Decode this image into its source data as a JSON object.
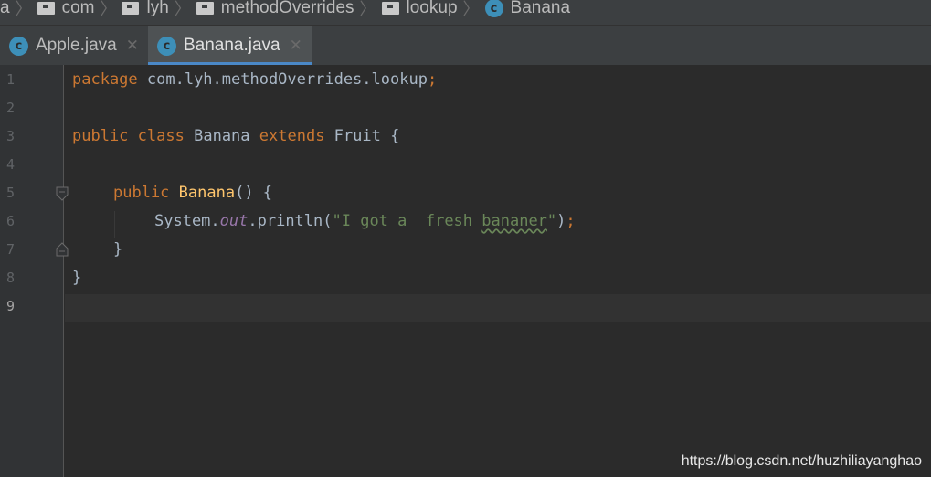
{
  "breadcrumb": {
    "items": [
      {
        "label": "a",
        "icon": "none"
      },
      {
        "label": "com",
        "icon": "folder-icon"
      },
      {
        "label": "lyh",
        "icon": "folder-icon"
      },
      {
        "label": "methodOverrides",
        "icon": "folder-icon"
      },
      {
        "label": "lookup",
        "icon": "folder-icon"
      },
      {
        "label": "Banana",
        "icon": "class-icon"
      }
    ]
  },
  "tabs": [
    {
      "label": "Apple.java",
      "icon_letter": "c",
      "active": false
    },
    {
      "label": "Banana.java",
      "icon_letter": "c",
      "active": true
    }
  ],
  "editor": {
    "line_numbers": [
      "1",
      "2",
      "3",
      "4",
      "5",
      "6",
      "7",
      "8",
      "9"
    ],
    "current_line": "9",
    "code": {
      "l1_kw": "package",
      "l1_rest": " com.lyh.methodOverrides.lookup",
      "l1_semi": ";",
      "l3_kw1": "public",
      "l3_kw2": "class",
      "l3_name": "Banana",
      "l3_kw3": "extends",
      "l3_rest": " Fruit {",
      "l5_kw": "public",
      "l5_fn": "Banana",
      "l5_rest": "() {",
      "l6_sys": "System.",
      "l6_out": "out",
      "l6_print": ".println(",
      "l6_str1": "\"I got a  fresh ",
      "l6_str_typo": "bananer",
      "l6_str2": "\"",
      "l6_end": ")",
      "l6_semi": ";",
      "l7": "}",
      "l8": "}"
    },
    "colors": {
      "keyword": "#cc7832",
      "function": "#ffc66d",
      "string": "#6a8759",
      "static_field": "#9876aa",
      "text": "#a9b7c6",
      "background": "#2b2b2b"
    }
  },
  "watermark": "https://blog.csdn.net/huzhiliayanghao"
}
